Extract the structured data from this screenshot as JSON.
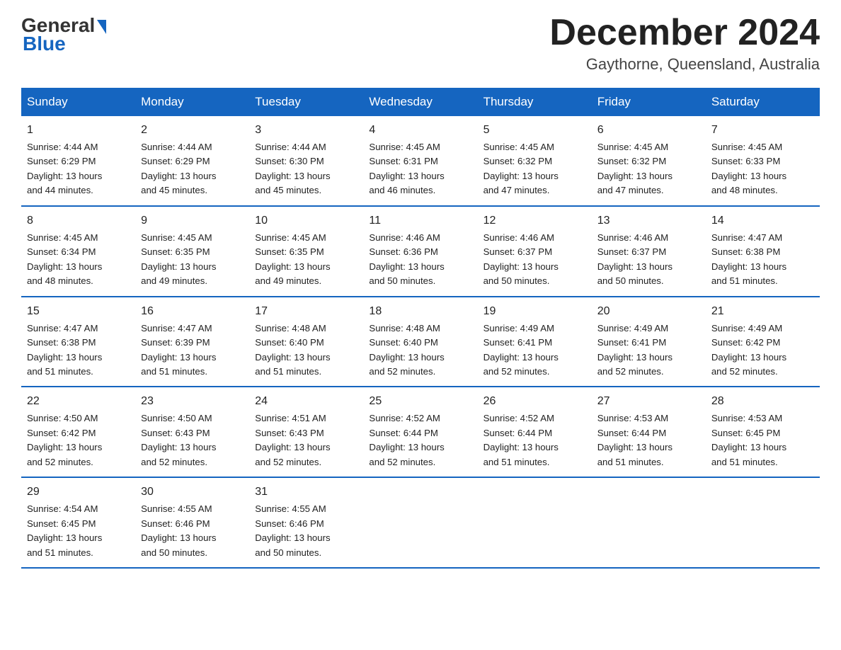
{
  "header": {
    "logo_text1": "General",
    "logo_text2": "Blue",
    "month": "December 2024",
    "location": "Gaythorne, Queensland, Australia"
  },
  "days_of_week": [
    "Sunday",
    "Monday",
    "Tuesday",
    "Wednesday",
    "Thursday",
    "Friday",
    "Saturday"
  ],
  "weeks": [
    [
      {
        "day": "1",
        "sunrise": "4:44 AM",
        "sunset": "6:29 PM",
        "daylight": "13 hours and 44 minutes."
      },
      {
        "day": "2",
        "sunrise": "4:44 AM",
        "sunset": "6:29 PM",
        "daylight": "13 hours and 45 minutes."
      },
      {
        "day": "3",
        "sunrise": "4:44 AM",
        "sunset": "6:30 PM",
        "daylight": "13 hours and 45 minutes."
      },
      {
        "day": "4",
        "sunrise": "4:45 AM",
        "sunset": "6:31 PM",
        "daylight": "13 hours and 46 minutes."
      },
      {
        "day": "5",
        "sunrise": "4:45 AM",
        "sunset": "6:32 PM",
        "daylight": "13 hours and 47 minutes."
      },
      {
        "day": "6",
        "sunrise": "4:45 AM",
        "sunset": "6:32 PM",
        "daylight": "13 hours and 47 minutes."
      },
      {
        "day": "7",
        "sunrise": "4:45 AM",
        "sunset": "6:33 PM",
        "daylight": "13 hours and 48 minutes."
      }
    ],
    [
      {
        "day": "8",
        "sunrise": "4:45 AM",
        "sunset": "6:34 PM",
        "daylight": "13 hours and 48 minutes."
      },
      {
        "day": "9",
        "sunrise": "4:45 AM",
        "sunset": "6:35 PM",
        "daylight": "13 hours and 49 minutes."
      },
      {
        "day": "10",
        "sunrise": "4:45 AM",
        "sunset": "6:35 PM",
        "daylight": "13 hours and 49 minutes."
      },
      {
        "day": "11",
        "sunrise": "4:46 AM",
        "sunset": "6:36 PM",
        "daylight": "13 hours and 50 minutes."
      },
      {
        "day": "12",
        "sunrise": "4:46 AM",
        "sunset": "6:37 PM",
        "daylight": "13 hours and 50 minutes."
      },
      {
        "day": "13",
        "sunrise": "4:46 AM",
        "sunset": "6:37 PM",
        "daylight": "13 hours and 50 minutes."
      },
      {
        "day": "14",
        "sunrise": "4:47 AM",
        "sunset": "6:38 PM",
        "daylight": "13 hours and 51 minutes."
      }
    ],
    [
      {
        "day": "15",
        "sunrise": "4:47 AM",
        "sunset": "6:38 PM",
        "daylight": "13 hours and 51 minutes."
      },
      {
        "day": "16",
        "sunrise": "4:47 AM",
        "sunset": "6:39 PM",
        "daylight": "13 hours and 51 minutes."
      },
      {
        "day": "17",
        "sunrise": "4:48 AM",
        "sunset": "6:40 PM",
        "daylight": "13 hours and 51 minutes."
      },
      {
        "day": "18",
        "sunrise": "4:48 AM",
        "sunset": "6:40 PM",
        "daylight": "13 hours and 52 minutes."
      },
      {
        "day": "19",
        "sunrise": "4:49 AM",
        "sunset": "6:41 PM",
        "daylight": "13 hours and 52 minutes."
      },
      {
        "day": "20",
        "sunrise": "4:49 AM",
        "sunset": "6:41 PM",
        "daylight": "13 hours and 52 minutes."
      },
      {
        "day": "21",
        "sunrise": "4:49 AM",
        "sunset": "6:42 PM",
        "daylight": "13 hours and 52 minutes."
      }
    ],
    [
      {
        "day": "22",
        "sunrise": "4:50 AM",
        "sunset": "6:42 PM",
        "daylight": "13 hours and 52 minutes."
      },
      {
        "day": "23",
        "sunrise": "4:50 AM",
        "sunset": "6:43 PM",
        "daylight": "13 hours and 52 minutes."
      },
      {
        "day": "24",
        "sunrise": "4:51 AM",
        "sunset": "6:43 PM",
        "daylight": "13 hours and 52 minutes."
      },
      {
        "day": "25",
        "sunrise": "4:52 AM",
        "sunset": "6:44 PM",
        "daylight": "13 hours and 52 minutes."
      },
      {
        "day": "26",
        "sunrise": "4:52 AM",
        "sunset": "6:44 PM",
        "daylight": "13 hours and 51 minutes."
      },
      {
        "day": "27",
        "sunrise": "4:53 AM",
        "sunset": "6:44 PM",
        "daylight": "13 hours and 51 minutes."
      },
      {
        "day": "28",
        "sunrise": "4:53 AM",
        "sunset": "6:45 PM",
        "daylight": "13 hours and 51 minutes."
      }
    ],
    [
      {
        "day": "29",
        "sunrise": "4:54 AM",
        "sunset": "6:45 PM",
        "daylight": "13 hours and 51 minutes."
      },
      {
        "day": "30",
        "sunrise": "4:55 AM",
        "sunset": "6:46 PM",
        "daylight": "13 hours and 50 minutes."
      },
      {
        "day": "31",
        "sunrise": "4:55 AM",
        "sunset": "6:46 PM",
        "daylight": "13 hours and 50 minutes."
      },
      null,
      null,
      null,
      null
    ]
  ]
}
